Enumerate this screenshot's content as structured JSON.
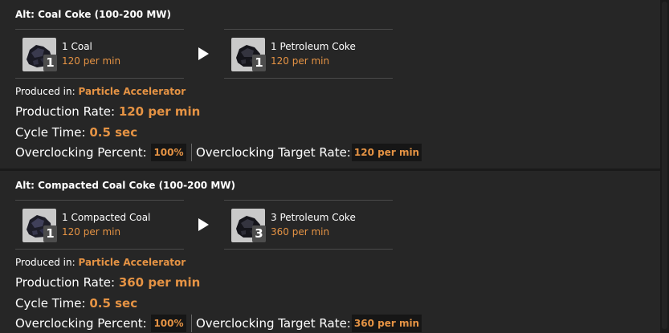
{
  "recipes": [
    {
      "title": "Alt: Coal Coke (100-200 MW)",
      "input": {
        "qty": "1",
        "name": "Coal",
        "rate": "120 per min",
        "icon": "coal-icon"
      },
      "output": {
        "qty": "1",
        "name": "Petroleum Coke",
        "rate": "120 per min",
        "icon": "petroleum-coke-icon"
      },
      "produced_label": "Produced in:",
      "building": "Particle Accelerator",
      "production_rate_label": "Production Rate:",
      "production_rate": "120 per min",
      "cycle_time_label": "Cycle Time:",
      "cycle_time": "0.5 sec",
      "overclock_label": "Overclocking Percent:",
      "overclock_value": "100%",
      "overclock_target_label": "Overclocking Target Rate:",
      "overclock_target_value": "120 per min"
    },
    {
      "title": "Alt: Compacted Coal Coke (100-200 MW)",
      "input": {
        "qty": "1",
        "name": "Compacted Coal",
        "rate": "120 per min",
        "icon": "compacted-coal-icon"
      },
      "output": {
        "qty": "3",
        "name": "Petroleum Coke",
        "rate": "360 per min",
        "icon": "petroleum-coke-icon"
      },
      "produced_label": "Produced in:",
      "building": "Particle Accelerator",
      "production_rate_label": "Production Rate:",
      "production_rate": "360 per min",
      "cycle_time_label": "Cycle Time:",
      "cycle_time": "0.5 sec",
      "overclock_label": "Overclocking Percent:",
      "overclock_value": "100%",
      "overclock_target_label": "Overclocking Target Rate:",
      "overclock_target_value": "360 per min"
    }
  ],
  "colors": {
    "accent": "#e59344",
    "panel": "#262626",
    "background": "#1b1b1b"
  }
}
